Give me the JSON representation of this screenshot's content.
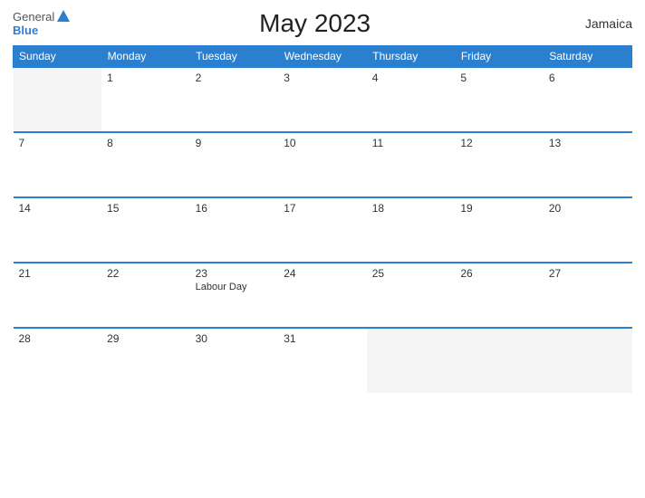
{
  "header": {
    "logo_general": "General",
    "logo_blue": "Blue",
    "title": "May 2023",
    "country": "Jamaica"
  },
  "days_of_week": [
    "Sunday",
    "Monday",
    "Tuesday",
    "Wednesday",
    "Thursday",
    "Friday",
    "Saturday"
  ],
  "weeks": [
    [
      {
        "day": "",
        "empty": true
      },
      {
        "day": "1",
        "empty": false
      },
      {
        "day": "2",
        "empty": false
      },
      {
        "day": "3",
        "empty": false
      },
      {
        "day": "4",
        "empty": false
      },
      {
        "day": "5",
        "empty": false
      },
      {
        "day": "6",
        "empty": false
      }
    ],
    [
      {
        "day": "7",
        "empty": false
      },
      {
        "day": "8",
        "empty": false
      },
      {
        "day": "9",
        "empty": false
      },
      {
        "day": "10",
        "empty": false
      },
      {
        "day": "11",
        "empty": false
      },
      {
        "day": "12",
        "empty": false
      },
      {
        "day": "13",
        "empty": false
      }
    ],
    [
      {
        "day": "14",
        "empty": false
      },
      {
        "day": "15",
        "empty": false
      },
      {
        "day": "16",
        "empty": false
      },
      {
        "day": "17",
        "empty": false
      },
      {
        "day": "18",
        "empty": false
      },
      {
        "day": "19",
        "empty": false
      },
      {
        "day": "20",
        "empty": false
      }
    ],
    [
      {
        "day": "21",
        "empty": false
      },
      {
        "day": "22",
        "empty": false
      },
      {
        "day": "23",
        "empty": false,
        "event": "Labour Day"
      },
      {
        "day": "24",
        "empty": false
      },
      {
        "day": "25",
        "empty": false
      },
      {
        "day": "26",
        "empty": false
      },
      {
        "day": "27",
        "empty": false
      }
    ],
    [
      {
        "day": "28",
        "empty": false
      },
      {
        "day": "29",
        "empty": false
      },
      {
        "day": "30",
        "empty": false
      },
      {
        "day": "31",
        "empty": false
      },
      {
        "day": "",
        "empty": true
      },
      {
        "day": "",
        "empty": true
      },
      {
        "day": "",
        "empty": true
      }
    ]
  ]
}
